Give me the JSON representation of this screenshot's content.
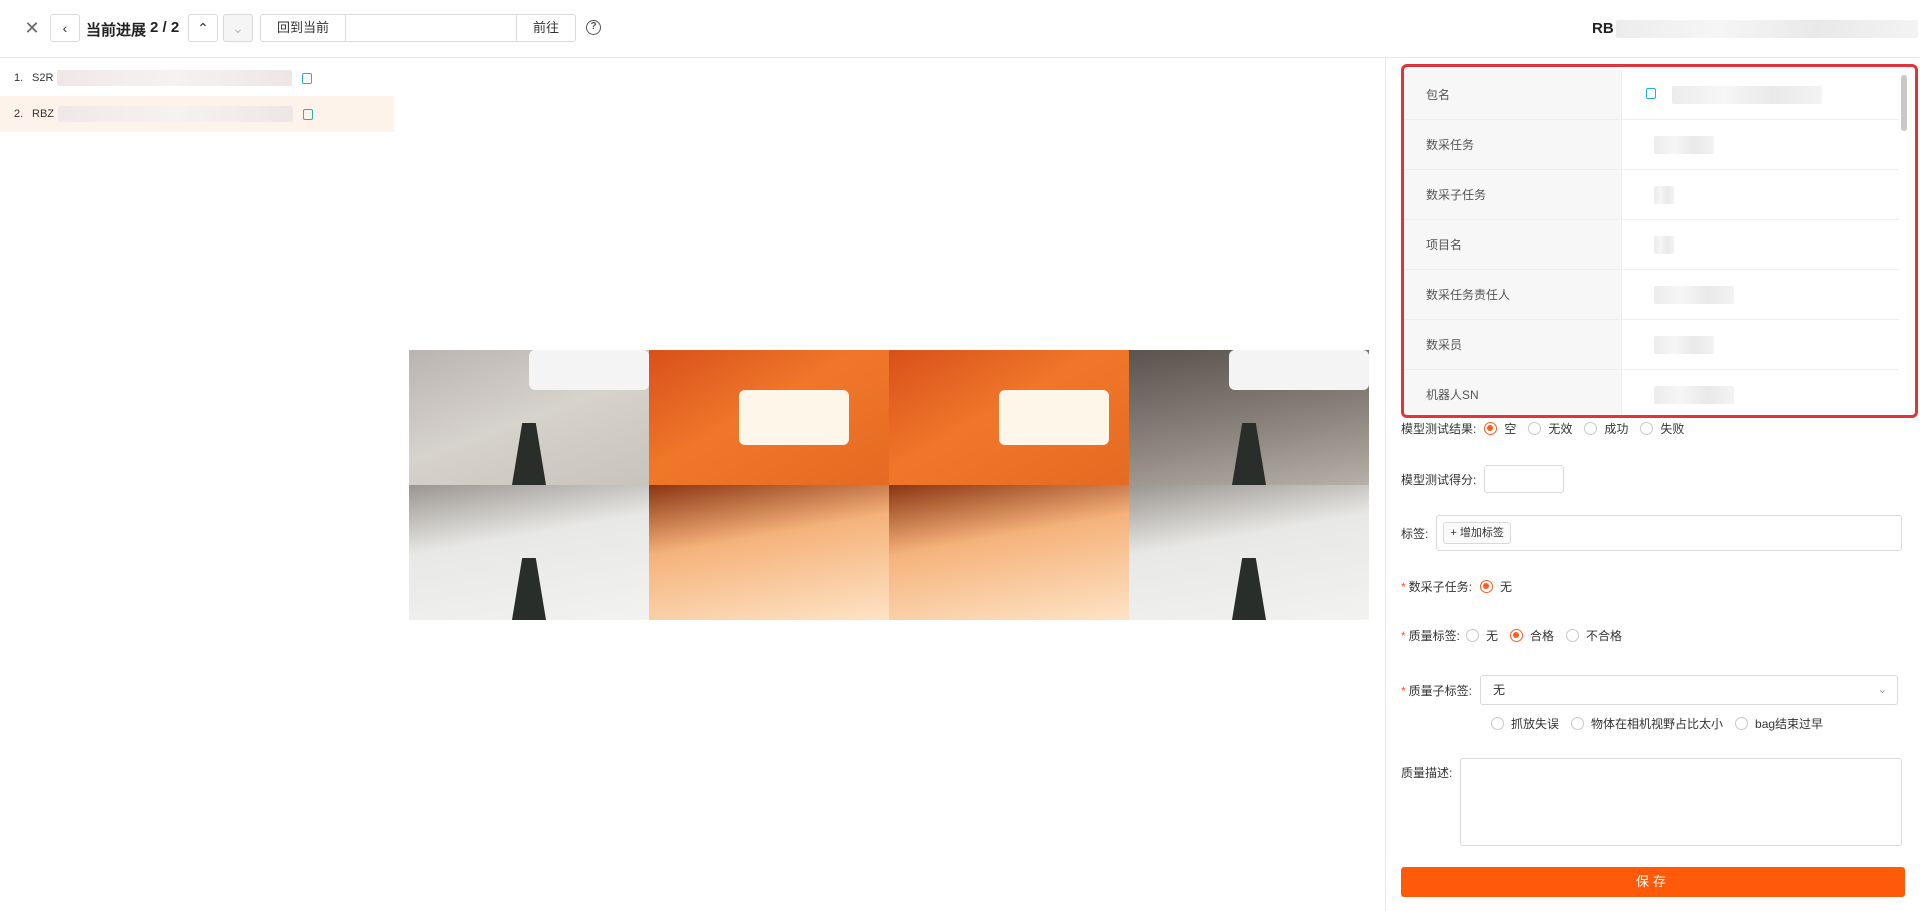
{
  "toolbar": {
    "progress_label": "当前进展",
    "progress_value": "2 / 2",
    "back_to_current": "回到当前",
    "goto_input": "",
    "goto_button": "前往",
    "package_code": "RB"
  },
  "list": [
    {
      "index": "1.",
      "prefix": "S2R",
      "active": false
    },
    {
      "index": "2.",
      "prefix": "RBZ",
      "active": true
    }
  ],
  "info": [
    {
      "key": "包名"
    },
    {
      "key": "数采任务"
    },
    {
      "key": "数采子任务"
    },
    {
      "key": "项目名"
    },
    {
      "key": "数采任务责任人"
    },
    {
      "key": "数采员"
    },
    {
      "key": "机器人SN"
    }
  ],
  "form": {
    "model_result": {
      "label": "模型测试结果:",
      "options": [
        "空",
        "无效",
        "成功",
        "失败"
      ],
      "selected": "空"
    },
    "model_score": {
      "label": "模型测试得分:",
      "value": ""
    },
    "tags": {
      "label": "标签:",
      "add_button": "增加标签"
    },
    "subtask": {
      "label": "数采子任务:",
      "options": [
        "无"
      ],
      "selected": "无"
    },
    "quality_tag": {
      "label": "质量标签:",
      "options": [
        "无",
        "合格",
        "不合格"
      ],
      "selected": "合格"
    },
    "quality_subtag": {
      "label": "质量子标签:",
      "value": "无",
      "options": [
        "抓放失误",
        "物体在相机视野占比太小",
        "bag结束过早"
      ]
    },
    "quality_desc": {
      "label": "质量描述:",
      "value": ""
    },
    "save": "保存"
  }
}
